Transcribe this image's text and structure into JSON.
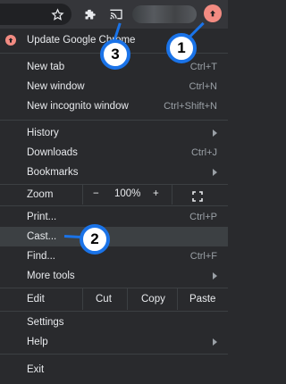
{
  "toolbar": {
    "icons": [
      "star-icon",
      "extensions-icon",
      "cast-icon",
      "update-icon"
    ]
  },
  "menu": {
    "update": "Update Google Chrome",
    "new_tab": {
      "label": "New tab",
      "shortcut": "Ctrl+T"
    },
    "new_window": {
      "label": "New window",
      "shortcut": "Ctrl+N"
    },
    "new_incognito": {
      "label": "New incognito window",
      "shortcut": "Ctrl+Shift+N"
    },
    "history": {
      "label": "History"
    },
    "downloads": {
      "label": "Downloads",
      "shortcut": "Ctrl+J"
    },
    "bookmarks": {
      "label": "Bookmarks"
    },
    "zoom": {
      "label": "Zoom",
      "minus": "−",
      "value": "100%",
      "plus": "+"
    },
    "print": {
      "label": "Print...",
      "shortcut": "Ctrl+P"
    },
    "cast": {
      "label": "Cast..."
    },
    "find": {
      "label": "Find...",
      "shortcut": "Ctrl+F"
    },
    "more_tools": {
      "label": "More tools"
    },
    "edit": {
      "label": "Edit",
      "cut": "Cut",
      "copy": "Copy",
      "paste": "Paste"
    },
    "settings": {
      "label": "Settings"
    },
    "help": {
      "label": "Help"
    },
    "exit": {
      "label": "Exit"
    }
  },
  "callouts": [
    "1",
    "2",
    "3"
  ],
  "colors": {
    "accent": "#1a73e8",
    "update": "#f28b82",
    "menu_bg": "#292a2d",
    "highlight": "#3c4043"
  }
}
